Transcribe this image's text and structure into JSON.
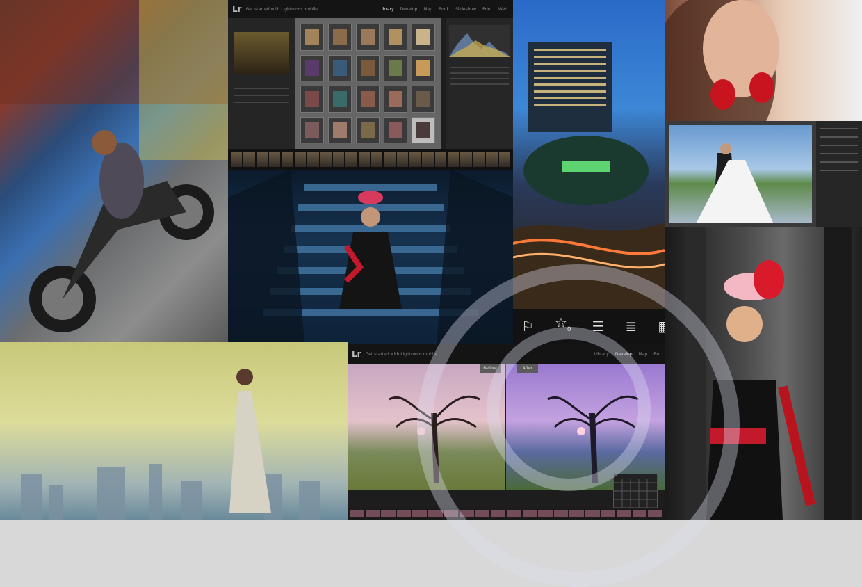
{
  "lr_top": {
    "logo": "Lr",
    "subtitle": "Get started with Lightroom mobile",
    "modules": [
      "Library",
      "Develop",
      "Map",
      "Book",
      "Slideshow",
      "Print",
      "Web"
    ],
    "active_module": "Library"
  },
  "toolbar": {
    "flag_icon": "flag-icon",
    "star_icon": "star-icon",
    "star_count": "0",
    "sliders_icon": "sliders-icon",
    "list_icon": "list-icon",
    "grid_icon": "grid-icon"
  },
  "lr_bottom": {
    "logo": "Lr",
    "subtitle": "Get started with Lightroom mobile",
    "modules": [
      "Library",
      "Develop",
      "Map",
      "Bo"
    ],
    "active_module": "Develop",
    "before_label": "Before",
    "after_label": "After"
  },
  "colors": {
    "lightroom_bg": "#1d1d1d",
    "grid_bg": "#656565",
    "watermark": "#dcdcf0"
  }
}
